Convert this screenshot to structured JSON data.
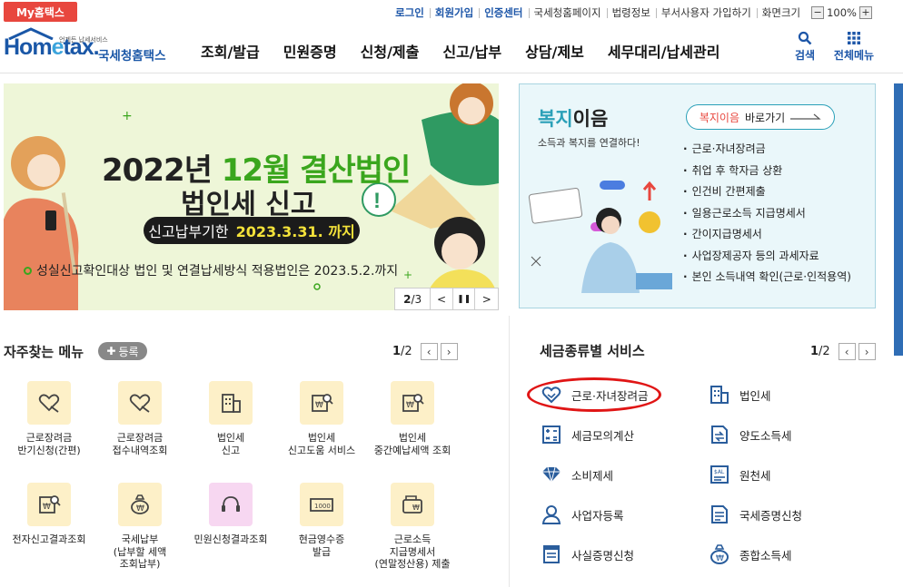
{
  "top": {
    "my_hometax": "My홈택스",
    "util_links": [
      "로그인",
      "회원가입",
      "인증센터",
      "국세청홈페이지",
      "법령정보",
      "부서사용자 가입하기",
      "화면크기"
    ],
    "zoom_minus": "−",
    "zoom_level": "100%",
    "zoom_plus": "+"
  },
  "header": {
    "logo_text_a": "Hom",
    "logo_text_e": "e",
    "logo_text_b": "tax.",
    "logo_tiny": "언제든 납세서비스",
    "logo_korean": "국세청홈택스",
    "nav": [
      "조회/발급",
      "민원증명",
      "신청/제출",
      "신고/납부",
      "상담/제보",
      "세무대리/납세관리"
    ],
    "search_label": "검색",
    "all_menu_label": "전체메뉴"
  },
  "banner": {
    "title_pre": "2022년 ",
    "title_green": "12월 결산법인",
    "title2": "법인세 신고",
    "pill_label": "신고납부기한",
    "pill_date": "2023.3.31. 까지",
    "note": "성실신고확인대상 법인 및 연결납세방식 적용법인은 2023.5.2.까지",
    "page_current": "2",
    "page_total": "/3",
    "prev": "<",
    "pause": "❚❚",
    "next": ">"
  },
  "welfare": {
    "title_color": "복지",
    "title_rest": "이음",
    "subtitle": "소득과 복지를 연결하다!",
    "link_color": "복지이음",
    "link_rest": "바로가기",
    "items": [
      "근로·자녀장려금",
      "취업 후 학자금 상환",
      "인건비 간편제출",
      "일용근로소득 지급명세서",
      "간이지급명세서",
      "사업장제공자 등의 과세자료",
      "본인 소득내역 확인(근로·인적용역)"
    ]
  },
  "favorites": {
    "title": "자주찾는 메뉴",
    "add_label": "등록",
    "page_current": "1",
    "page_total": "/2",
    "items": [
      {
        "label": "근로장려금\n반기신청(간편)",
        "icon": "heart-hand-icon"
      },
      {
        "label": "근로장려금\n접수내역조회",
        "icon": "heart-hand-icon"
      },
      {
        "label": "법인세\n신고",
        "icon": "building-icon"
      },
      {
        "label": "법인세\n신고도움 서비스",
        "icon": "document-search-icon"
      },
      {
        "label": "법인세\n중간예납세액 조회",
        "icon": "document-search-icon"
      },
      {
        "label": "전자신고결과조회",
        "icon": "document-search-icon"
      },
      {
        "label": "국세납부\n(납부할 세액\n조회납부)",
        "icon": "money-bag-icon"
      },
      {
        "label": "민원신청결과조회",
        "icon": "headset-icon"
      },
      {
        "label": "현금영수증\n발급",
        "icon": "receipt-icon"
      },
      {
        "label": "근로소득\n지급명세서\n(연말정산용) 제출",
        "icon": "wallet-icon"
      }
    ]
  },
  "tax_services": {
    "title": "세금종류별 서비스",
    "page_current": "1",
    "page_total": "/2",
    "items": [
      {
        "label": "근로·자녀장려금",
        "icon": "heart-hand-icon"
      },
      {
        "label": "법인세",
        "icon": "building-icon"
      },
      {
        "label": "세금모의계산",
        "icon": "calculator-icon"
      },
      {
        "label": "양도소득세",
        "icon": "transfer-document-icon"
      },
      {
        "label": "소비제세",
        "icon": "diamond-icon"
      },
      {
        "label": "원천세",
        "icon": "receipt-icon"
      },
      {
        "label": "사업자등록",
        "icon": "person-icon"
      },
      {
        "label": "국세증명신청",
        "icon": "certificate-icon"
      },
      {
        "label": "사실증명신청",
        "icon": "document-icon"
      },
      {
        "label": "종합소득세",
        "icon": "money-bag-icon"
      }
    ]
  },
  "colors": {
    "brand_blue": "#1a57a7",
    "accent_red": "#e8473e",
    "banner_green": "#3aa61d",
    "welfare_teal": "#2aa0b8",
    "annotation_red": "#e01515"
  }
}
